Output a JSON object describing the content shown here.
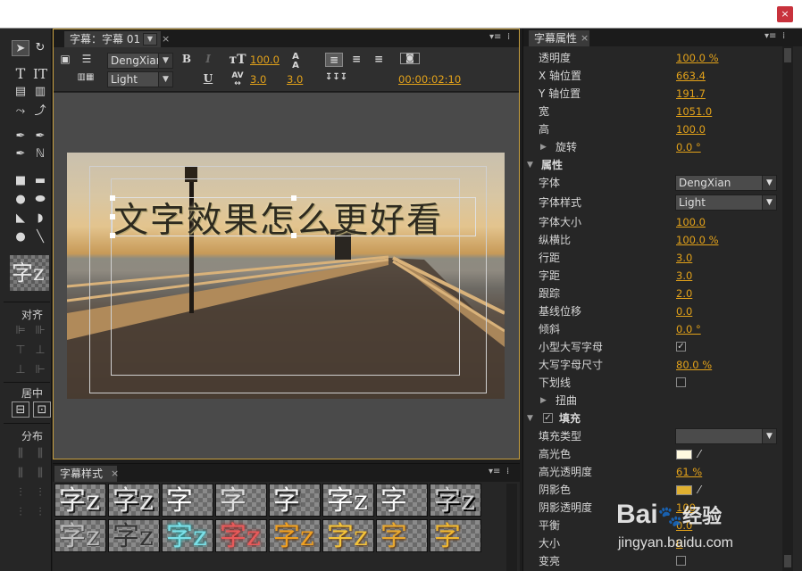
{
  "window": {
    "close_label": "×"
  },
  "tools_panel": {
    "align_label": "对齐",
    "center_label": "居中",
    "distribute_label": "分布",
    "style_preview": "字z"
  },
  "title_panel": {
    "tab_label": "字幕：字幕 01",
    "font_family": "DengXian",
    "font_style": "Light",
    "font_size": "100.0",
    "kerning": "3.0",
    "leading": "3.0",
    "timecode": "00:00:02:10",
    "title_text": "文字效果怎么更好看"
  },
  "styles_panel": {
    "tab_label": "字幕样式",
    "swatches": [
      "字z",
      "字z",
      "字",
      "字",
      "字",
      "字z",
      "字",
      "字z",
      "字z",
      "字z",
      "字z",
      "字z",
      "字z",
      "字z",
      "字",
      "字"
    ]
  },
  "props_panel": {
    "tab_label": "字幕属性",
    "rows": [
      {
        "label": "透明度",
        "value": "100.0 %"
      },
      {
        "label": "X 轴位置",
        "value": "663.4"
      },
      {
        "label": "Y 轴位置",
        "value": "191.7"
      },
      {
        "label": "宽",
        "value": "1051.0"
      },
      {
        "label": "高",
        "value": "100.0"
      },
      {
        "label": "旋转",
        "value": "0.0 °"
      }
    ],
    "properties_section": "属性",
    "prop_rows": [
      {
        "label": "字体",
        "value": "DengXian"
      },
      {
        "label": "字体样式",
        "value": "Light"
      },
      {
        "label": "字体大小",
        "value": "100.0"
      },
      {
        "label": "纵横比",
        "value": "100.0 %"
      },
      {
        "label": "行距",
        "value": "3.0"
      },
      {
        "label": "字距",
        "value": "3.0"
      },
      {
        "label": "跟踪",
        "value": "2.0"
      },
      {
        "label": "基线位移",
        "value": "0.0"
      },
      {
        "label": "倾斜",
        "value": "0.0 °"
      },
      {
        "label": "小型大写字母",
        "value": ""
      },
      {
        "label": "大写字母尺寸",
        "value": "80.0 %"
      },
      {
        "label": "下划线",
        "value": ""
      },
      {
        "label": "扭曲",
        "value": ""
      }
    ],
    "fill_section": "填充",
    "fill_rows": [
      {
        "label": "填充类型",
        "value": ""
      },
      {
        "label": "高光色",
        "value": ""
      },
      {
        "label": "高光透明度",
        "value": "61 %"
      },
      {
        "label": "阴影色",
        "value": ""
      },
      {
        "label": "阴影透明度",
        "value": "100"
      },
      {
        "label": "平衡",
        "value": "0.0"
      },
      {
        "label": "大小",
        "value": "0"
      },
      {
        "label": "变亮",
        "value": ""
      }
    ]
  },
  "watermark": {
    "brand": "Bai",
    "brand2": "经验",
    "url": "jingyan.baidu.com"
  },
  "colors": {
    "accent": "#e3a21a",
    "highlight_color": "#fff9e0",
    "shadow_color": "#e0b030"
  }
}
